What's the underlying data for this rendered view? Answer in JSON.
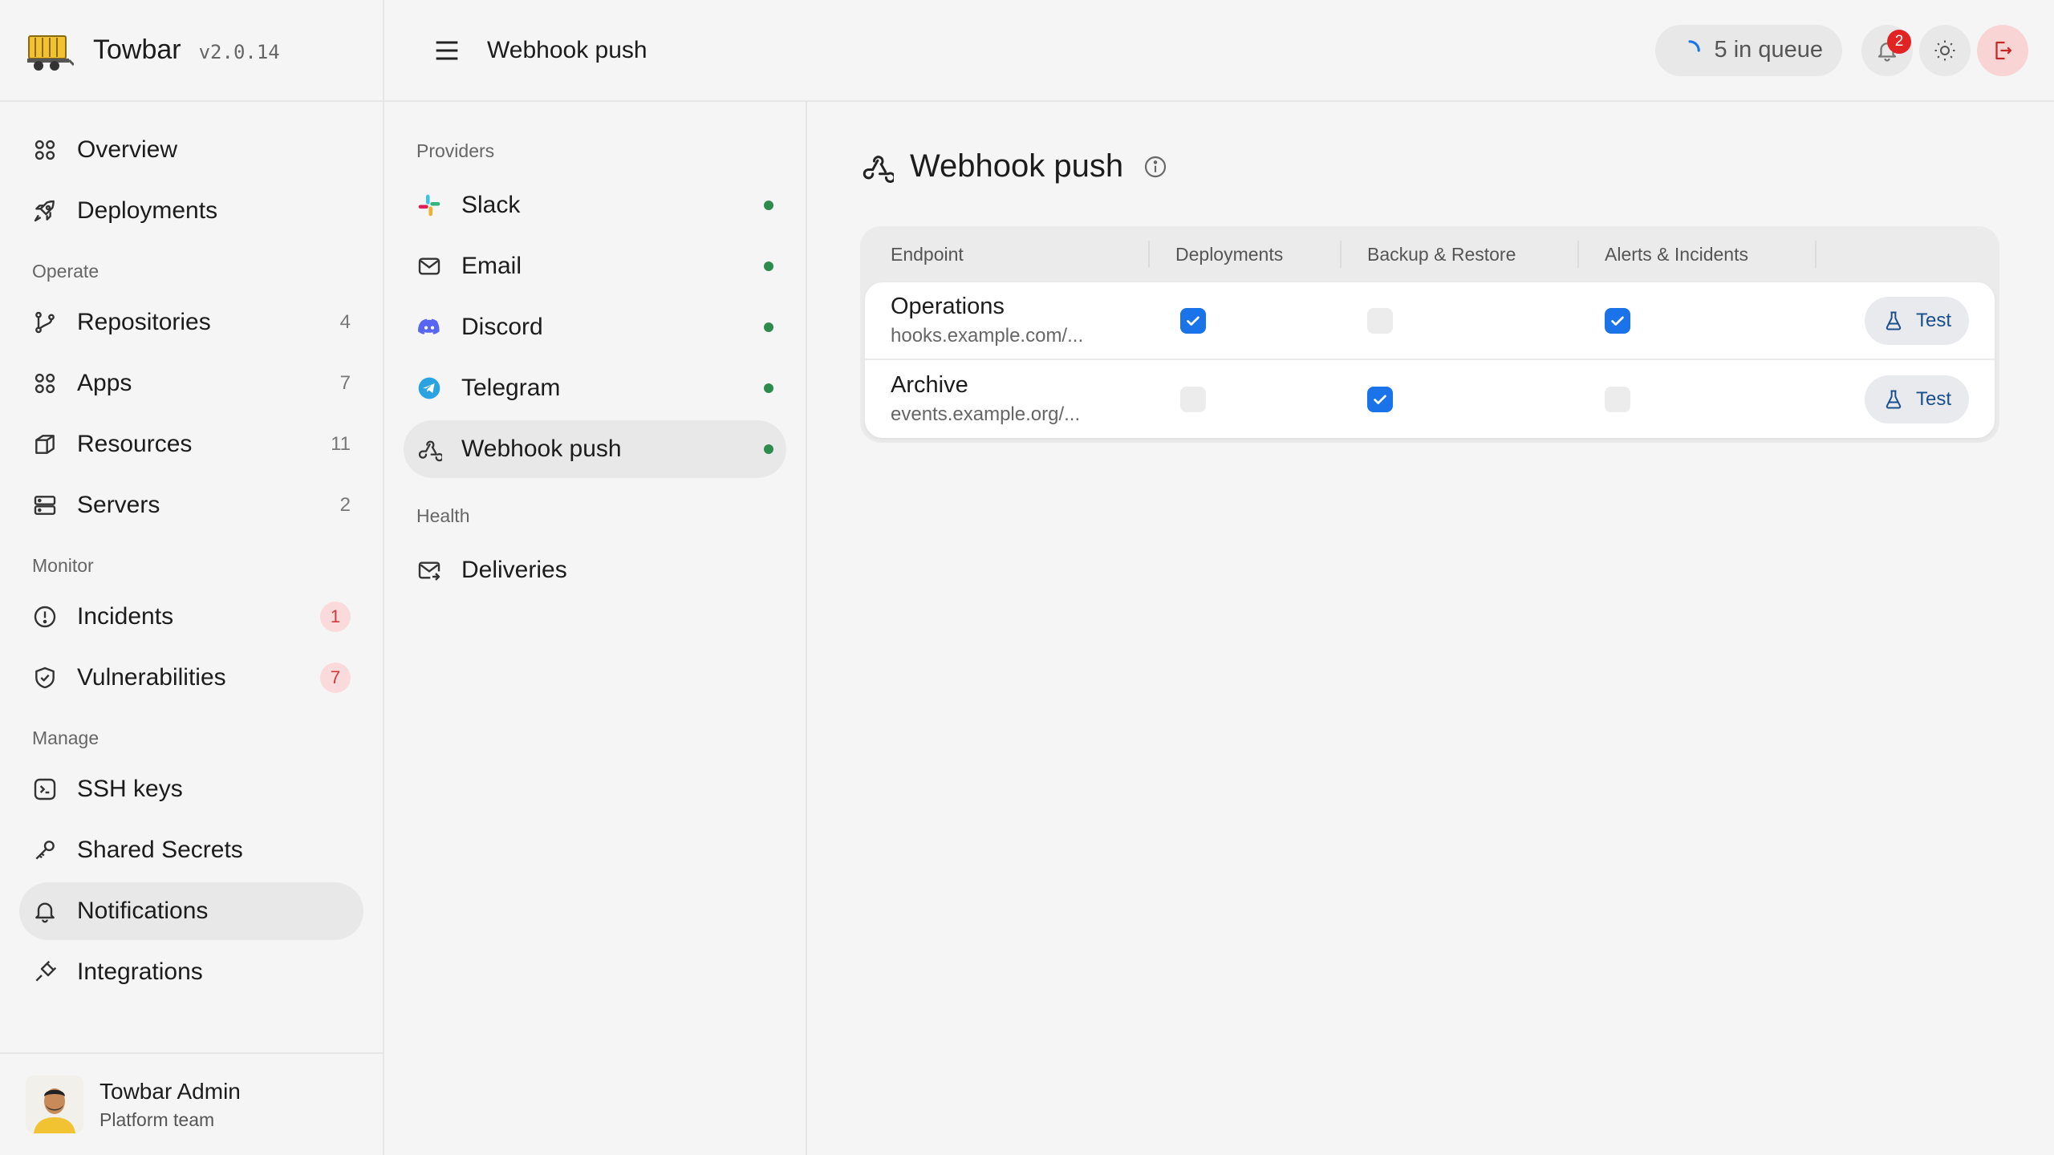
{
  "brand": {
    "name": "Towbar",
    "version": "v2.0.14"
  },
  "sidebar": {
    "items_top": [
      {
        "label": "Overview",
        "icon": "grid-icon"
      },
      {
        "label": "Deployments",
        "icon": "rocket-icon"
      }
    ],
    "sections": {
      "operate": "Operate",
      "monitor": "Monitor",
      "manage": "Manage"
    },
    "operate": [
      {
        "label": "Repositories",
        "count": "4"
      },
      {
        "label": "Apps",
        "count": "7"
      },
      {
        "label": "Resources",
        "count": "11"
      },
      {
        "label": "Servers",
        "count": "2"
      }
    ],
    "monitor": [
      {
        "label": "Incidents",
        "count": "1"
      },
      {
        "label": "Vulnerabilities",
        "count": "7"
      }
    ],
    "manage": [
      {
        "label": "SSH keys"
      },
      {
        "label": "Shared Secrets"
      },
      {
        "label": "Notifications"
      },
      {
        "label": "Integrations"
      }
    ],
    "active": "Notifications"
  },
  "user": {
    "name": "Towbar Admin",
    "team": "Platform team"
  },
  "topbar": {
    "title": "Webhook push",
    "queue": "5 in queue",
    "notification_count": "2"
  },
  "subnav": {
    "providers_label": "Providers",
    "providers": [
      {
        "label": "Slack"
      },
      {
        "label": "Email"
      },
      {
        "label": "Discord"
      },
      {
        "label": "Telegram"
      },
      {
        "label": "Webhook push"
      }
    ],
    "health_label": "Health",
    "health": [
      {
        "label": "Deliveries"
      }
    ],
    "active": "Webhook push",
    "status_color": "#2e8b4e"
  },
  "panel": {
    "title": "Webhook push",
    "columns": [
      "Endpoint",
      "Deployments",
      "Backup & Restore",
      "Alerts & Incidents"
    ],
    "rows": [
      {
        "name": "Operations",
        "url": "hooks.example.com/...",
        "deployments": true,
        "backup": false,
        "alerts": true,
        "action": "Test"
      },
      {
        "name": "Archive",
        "url": "events.example.org/...",
        "deployments": false,
        "backup": true,
        "alerts": false,
        "action": "Test"
      }
    ]
  },
  "colors": {
    "accent": "#1a73e8",
    "danger": "#e02424"
  }
}
